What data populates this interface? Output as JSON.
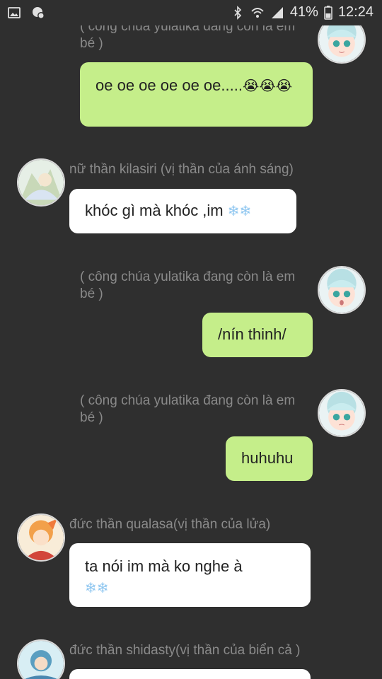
{
  "status_bar": {
    "battery_percent": "41%",
    "time": "12:24",
    "icons": [
      "image-icon",
      "android-settings-icon",
      "bluetooth-icon",
      "wifi-icon",
      "signal-icon",
      "battery-icon"
    ]
  },
  "messages": [
    {
      "sender": "( công chúa yulatika đang còn là em bé )",
      "side": "right",
      "text": "oe oe oe oe oe oe.....",
      "emoji": "😭😭😭",
      "bubble_color": "#c5ee8a"
    },
    {
      "sender": "nữ thần kilasiri  (vị thần của ánh sáng)",
      "side": "left",
      "text": "khóc gì mà khóc ,im",
      "emoji": "❄❄",
      "bubble_color": "#ffffff"
    },
    {
      "sender": "( công chúa yulatika đang còn là em bé )",
      "side": "right",
      "text": "/nín thinh/",
      "bubble_color": "#c5ee8a"
    },
    {
      "sender": "( công chúa yulatika đang còn là em bé )",
      "side": "right",
      "text": "huhuhu",
      "bubble_color": "#c5ee8a"
    },
    {
      "sender": "đức thần qualasa(vị thần của lửa)",
      "side": "left",
      "text": "ta nói im mà ko nghe à",
      "emoji": "❄❄",
      "bubble_color": "#ffffff"
    },
    {
      "sender": "đức thần shidasty(vị thần của biển cả )",
      "side": "left",
      "text": "",
      "bubble_color": "#ffffff"
    }
  ]
}
